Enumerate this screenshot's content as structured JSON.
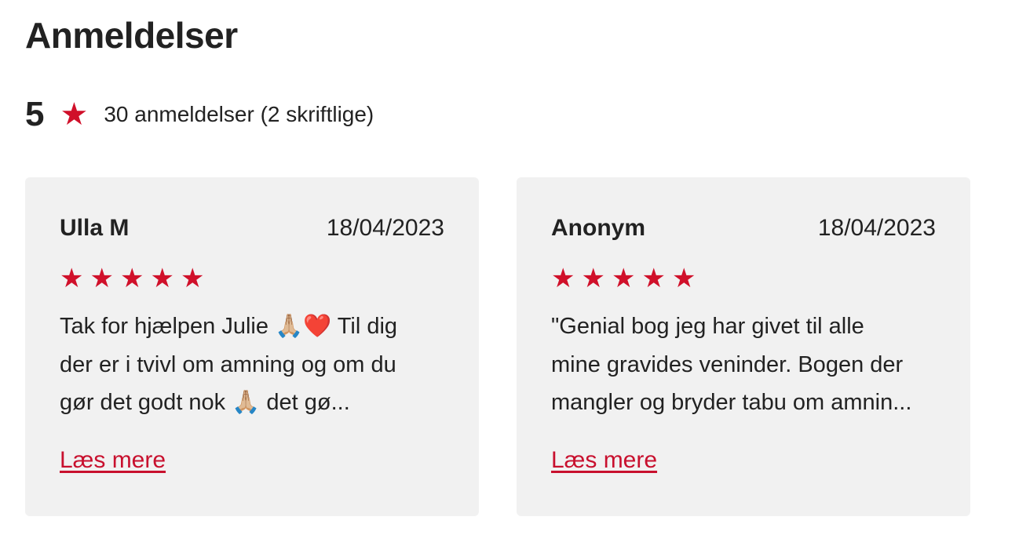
{
  "heading": "Anmeldelser",
  "summary": {
    "score": "5",
    "star_icon": "star-icon",
    "count_text": "30 anmeldelser (2 skriftlige)",
    "rating_value": 5,
    "rating_max": 5
  },
  "colors": {
    "accent": "#d0102a",
    "card_background": "#f1f1f1",
    "text": "#222222"
  },
  "reviews": [
    {
      "author": "Ulla M",
      "date": "18/04/2023",
      "stars": 5,
      "text": "Tak for hjælpen Julie 🙏🏼❤️  Til dig\nder er i tvivl om amning og om du\ngør det godt nok 🙏🏼 det gø...",
      "read_more": "Læs mere"
    },
    {
      "author": "Anonym",
      "date": "18/04/2023",
      "stars": 5,
      "text": "\"Genial bog jeg har givet til alle\nmine gravides veninder. Bogen der\nmangler og bryder tabu om amnin...",
      "read_more": "Læs mere"
    }
  ]
}
